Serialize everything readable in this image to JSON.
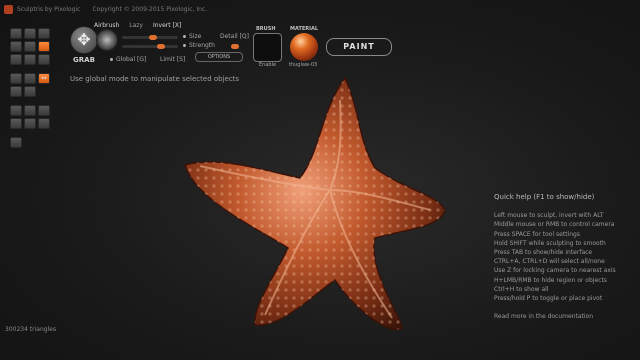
{
  "titlebar": {
    "app": "Sculptris by Pixologic",
    "copyright": "Copyright © 2009-2015 Pixologic, Inc."
  },
  "tools": {
    "rows": [
      [
        "",
        "",
        ""
      ],
      [
        "",
        "",
        ""
      ],
      [
        "",
        "",
        ""
      ],
      [
        "",
        "",
        ""
      ],
      [
        "",
        "",
        ""
      ],
      [
        "",
        "",
        "⇔"
      ],
      [
        "",
        "",
        ""
      ],
      [
        "",
        "",
        ""
      ],
      [
        ""
      ]
    ]
  },
  "brush": {
    "name": "GRAB",
    "mode_airbrush": "Airbrush",
    "mode_lazy": "Lazy",
    "mode_invert": "Invert [X]",
    "size_label": "Size",
    "strength_label": "Strength",
    "detail_label": "Detail [Q]",
    "global_label": "Global [G]",
    "limit_label": "Limit [S]",
    "options_label": "OPTIONS",
    "size": 0.55,
    "strength": 0.7,
    "detail": 0.5
  },
  "brush_slot": {
    "label": "BRUSH",
    "state": "Enable"
  },
  "material": {
    "label": "MATERIAL",
    "name": "thuglaw-03"
  },
  "paint_button": "PAINT",
  "hint": "Use global mode to manipulate selected objects",
  "quick_help": {
    "title": "Quick help (F1 to show/hide)",
    "lines": [
      "Left mouse to sculpt, invert with ALT",
      "Middle mouse or RMB to control camera",
      "Press SPACE for tool settings",
      "Hold SHIFT while sculpting to smooth",
      "Press TAB to show/hide interface",
      "CTRL+A, CTRL+D will select all/none",
      "Use Z for locking camera to nearest axis",
      "H+LMB/RMB to hide region or objects",
      "Ctrl+H to show all",
      "Press/hold P to toggle or place pivot"
    ],
    "more": "Read more in the documentation"
  },
  "status": "300234 triangles",
  "colors": {
    "accent": "#e07030",
    "background": "#1c1c1c",
    "model": "#c0582a"
  }
}
